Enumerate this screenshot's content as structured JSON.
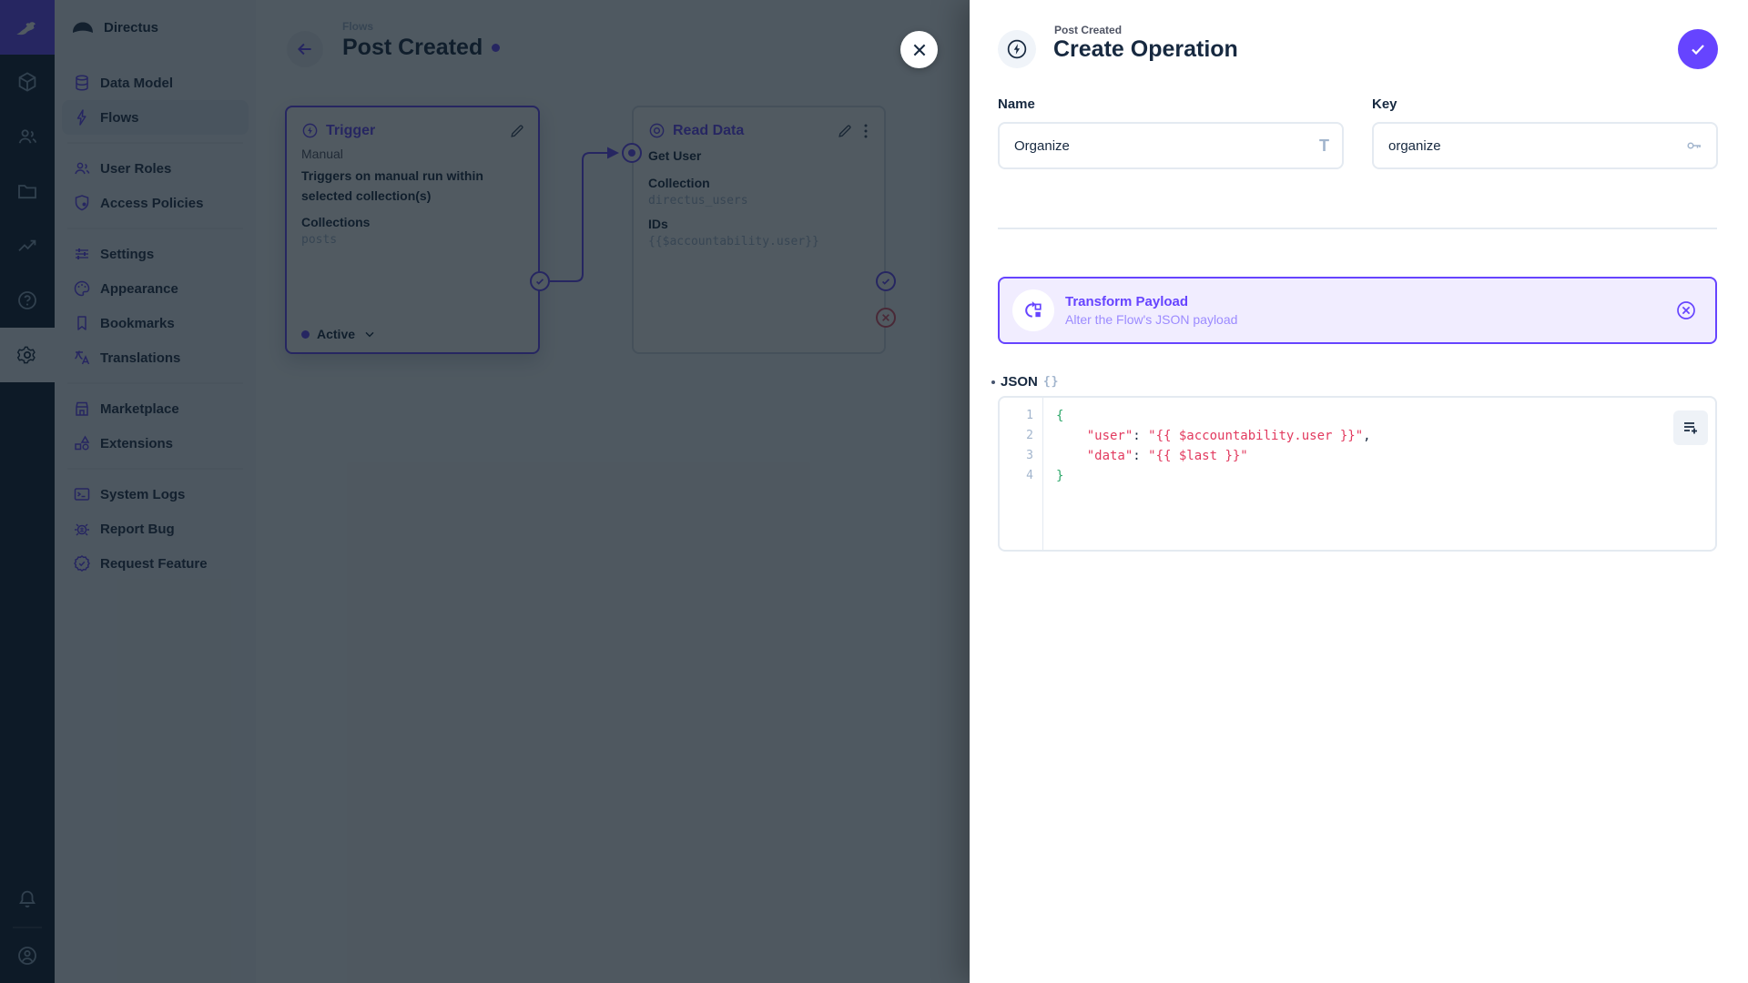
{
  "colors": {
    "accent": "#6644ff",
    "dark": "#172940",
    "muted": "#a2b5cd",
    "reject": "#e35169",
    "code_string": "#e23a5f",
    "code_brace": "#2fa86b"
  },
  "icons": [
    "directus-rabbit-icon",
    "cube-icon",
    "users-icon",
    "folder-icon",
    "chart-icon",
    "help-icon",
    "gear-icon",
    "bell-icon",
    "avatar-icon",
    "cloud-logo-icon",
    "database-icon",
    "bolt-icon",
    "shield-icon",
    "tune-icon",
    "palette-icon",
    "bookmark-icon",
    "translate-icon",
    "storefront-icon",
    "extensions-icon",
    "terminal-icon",
    "bug-icon",
    "feature-icon",
    "back-arrow-icon",
    "pencil-icon",
    "kebab-icon",
    "eye-icon",
    "check-icon",
    "close-icon",
    "transform-icon",
    "remove-circle-icon",
    "title-icon",
    "key-icon",
    "braces-icon",
    "playlist-add-icon",
    "chevron-down-icon"
  ],
  "nav": {
    "project_name": "Directus",
    "groups": [
      {
        "items": [
          {
            "label": "Data Model"
          },
          {
            "label": "Flows"
          }
        ]
      },
      {
        "items": [
          {
            "label": "User Roles"
          },
          {
            "label": "Access Policies"
          }
        ]
      },
      {
        "items": [
          {
            "label": "Settings"
          },
          {
            "label": "Appearance"
          },
          {
            "label": "Bookmarks"
          },
          {
            "label": "Translations"
          }
        ]
      },
      {
        "items": [
          {
            "label": "Marketplace"
          },
          {
            "label": "Extensions"
          }
        ]
      },
      {
        "items": [
          {
            "label": "System Logs"
          },
          {
            "label": "Report Bug"
          },
          {
            "label": "Request Feature"
          }
        ]
      }
    ]
  },
  "flow_header": {
    "breadcrumb": "Flows",
    "title": "Post Created"
  },
  "trigger_panel": {
    "title": "Trigger",
    "type": "Manual",
    "description": "Triggers on manual run within selected collection(s)",
    "collections_label": "Collections",
    "collections_value": "posts",
    "status": "Active"
  },
  "read_panel": {
    "title": "Read Data",
    "name": "Get User",
    "collection_label": "Collection",
    "collection_value": "directus_users",
    "ids_label": "IDs",
    "ids_value": "{{$accountability.user}}"
  },
  "drawer": {
    "context": "Post Created",
    "title": "Create Operation",
    "name_field": {
      "label": "Name",
      "value": "Organize",
      "icon_glyph": "T"
    },
    "key_field": {
      "label": "Key",
      "value": "organize"
    },
    "operation_card": {
      "title": "Transform Payload",
      "subtitle": "Alter the Flow's JSON payload"
    },
    "json_field": {
      "label": "JSON",
      "icon_text": "{}"
    },
    "editor": {
      "line_numbers": [
        "1",
        "2",
        "3",
        "4"
      ],
      "l1": "{",
      "l2": {
        "indent": "    ",
        "key": "\"user\"",
        "sep": ": ",
        "value": "\"{{ $accountability.user }}\"",
        "tail": ","
      },
      "l3": {
        "indent": "    ",
        "key": "\"data\"",
        "sep": ": ",
        "value": "\"{{ $last }}\"",
        "tail": ""
      },
      "l4": "}"
    }
  }
}
